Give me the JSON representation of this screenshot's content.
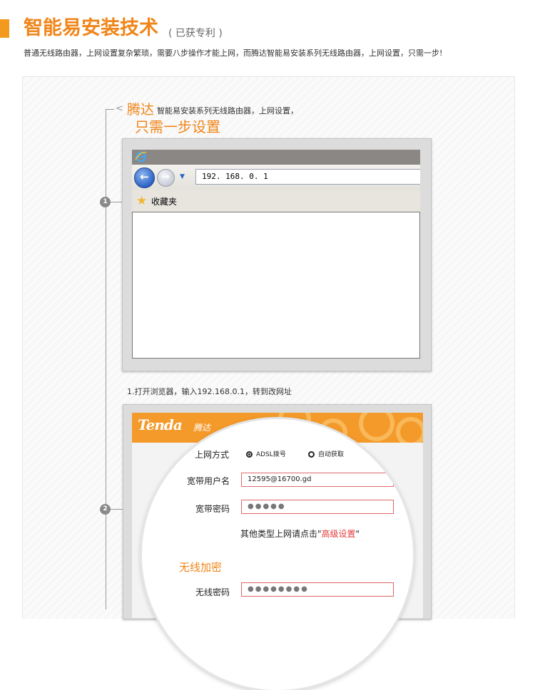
{
  "header": {
    "title": "智能易安装技术",
    "title_sub": "( 已获专利 )",
    "description": "普通无线路由器，上网设置复杂繁琐，需要八步操作才能上网，而腾达智能易安装系列无线路由器，上网设置，只需一步!"
  },
  "intro": {
    "brand": "腾达",
    "brand_rest": "智能易安装系列无线路由器，上网设置，",
    "headline": "只需一步设置"
  },
  "markers": [
    "1",
    "2"
  ],
  "browser": {
    "address": "192. 168. 0. 1",
    "favorites_label": "收藏夹",
    "icons": [
      "ie-icon",
      "back-arrow-icon",
      "forward-arrow-icon",
      "dropdown-icon",
      "favorites-star-icon"
    ]
  },
  "step1_caption": "1.打开浏览器，输入192.168.0.1，转到改网址",
  "router": {
    "logo": "Tenda",
    "logo_cn": "腾达",
    "accent_color": "#f49a2b",
    "conn_type_label": "上网方式",
    "conn_options": [
      {
        "label": "ADSL拨号",
        "selected": true
      },
      {
        "label": "自动获取",
        "selected": false
      }
    ],
    "username_label": "宽带用户名",
    "username_value": "12595@16700.gd",
    "password_label": "宽带密码",
    "password_value": "●●●●●",
    "other_hint_prefix": "其他类型上网请点击\"",
    "other_hint_link": "高级设置",
    "other_hint_suffix": "\"",
    "wifi_heading": "无线加密",
    "wifi_password_label": "无线密码",
    "wifi_password_value": "●●●●●●●●"
  }
}
